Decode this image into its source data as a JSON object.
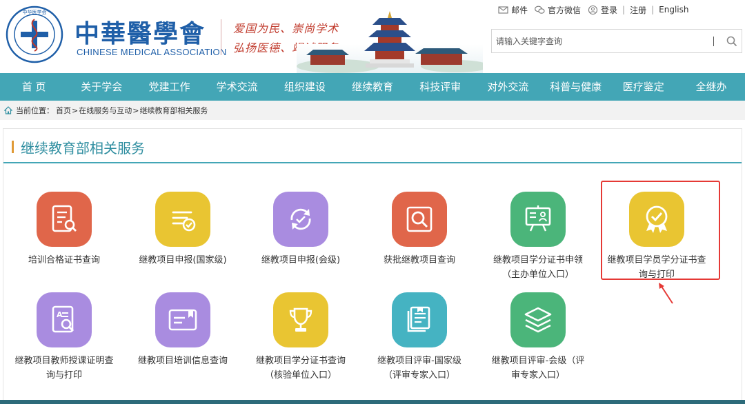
{
  "header": {
    "logo_cn": "中華醫學會",
    "logo_en": "CHINESE MEDICAL ASSOCIATION",
    "slogan_line1": "爱国为民、崇尚学术",
    "slogan_line2": "弘扬医德、竭诚服务",
    "top_links": {
      "mail": "邮件",
      "wechat": "官方微信",
      "login": "登录",
      "register": "注册",
      "english": "English"
    },
    "search_placeholder": "请输入关键字查询"
  },
  "nav": {
    "items": [
      "首 页",
      "关于学会",
      "党建工作",
      "学术交流",
      "组织建设",
      "继续教育",
      "科技评审",
      "对外交流",
      "科普与健康",
      "医疗鉴定",
      "全继办"
    ]
  },
  "breadcrumb": {
    "label": "当前位置：",
    "items": [
      "首页",
      "在线服务与互动",
      "继续教育部相关服务"
    ],
    "separator": ">"
  },
  "section": {
    "title": "继续教育部相关服务"
  },
  "services": [
    {
      "line1": "培训合格证书查询",
      "line2": "",
      "icon": "certificate-search-icon",
      "color": "#e0664a"
    },
    {
      "line1": "继教项目申报(国家级)",
      "line2": "",
      "icon": "checklist-icon",
      "color": "#e9c532"
    },
    {
      "line1": "继教项目申报(会级)",
      "line2": "",
      "icon": "refresh-check-icon",
      "color": "#a98ce0"
    },
    {
      "line1": "获批继教项目查询",
      "line2": "",
      "icon": "magnifier-icon",
      "color": "#e0664a"
    },
    {
      "line1": "继教项目学分证书申领",
      "line2": "（主办单位入口）",
      "icon": "presentation-board-icon",
      "color": "#4bb57a"
    },
    {
      "line1": "继教项目学员学分证书查",
      "line2": "询与打印",
      "icon": "award-badge-icon",
      "color": "#e9c532"
    },
    {
      "line1": "继教项目教师授课证明查",
      "line2": "询与打印",
      "icon": "document-search-icon",
      "color": "#a98ce0"
    },
    {
      "line1": "继教项目培训信息查询",
      "line2": "",
      "icon": "id-card-icon",
      "color": "#a98ce0"
    },
    {
      "line1": "继教项目学分证书查询",
      "line2": "（核验单位入口）",
      "icon": "trophy-icon",
      "color": "#e9c532"
    },
    {
      "line1": "继教项目评审-国家级",
      "line2": "（评审专家入口）",
      "icon": "book-stack-icon",
      "color": "#45b3c2"
    },
    {
      "line1": "继教项目评审-会级（评",
      "line2": "审专家入口）",
      "icon": "layers-icon",
      "color": "#4bb57a"
    }
  ]
}
